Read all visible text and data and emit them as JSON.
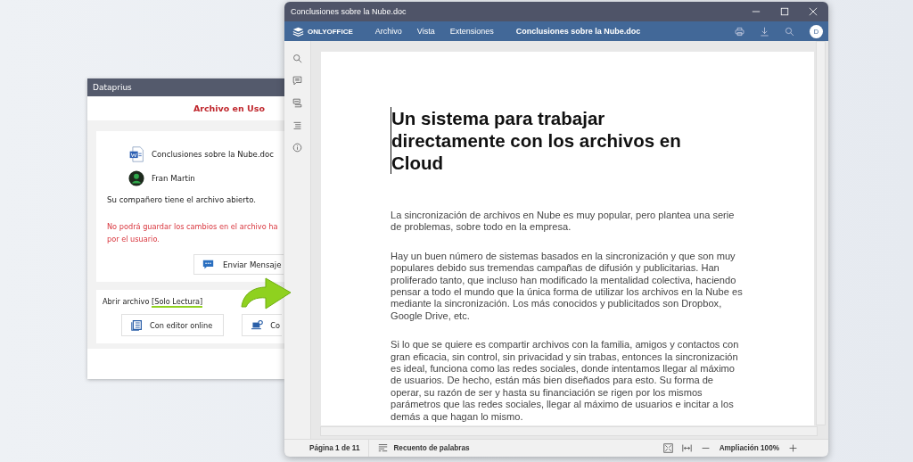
{
  "dialog": {
    "title": "Dataprius",
    "heading": "Archivo en Uso",
    "file_name": "Conclusiones sobre la Nube.doc",
    "user_name": "Fran Martin",
    "info": "Su compañero tiene el archivo abierto.",
    "warning_lines": [
      "No podrá guardar los cambios en el archivo  ha",
      "por el usuario."
    ],
    "message_button": "Enviar Mensaje",
    "open_label_prefix": "Abrir archivo ",
    "open_label_highlight": "[Solo Lectura]",
    "open_buttons": [
      {
        "label": "Con editor online",
        "kind": "online"
      },
      {
        "label": "Co",
        "kind": "desktop"
      }
    ]
  },
  "editor": {
    "window_title": "Conclusiones sobre la Nube.doc",
    "brand": "ONLYOFFICE",
    "menu": [
      "Archivo",
      "Vista",
      "Extensiones"
    ],
    "doc_title": "Conclusiones sobre la Nube.doc",
    "user_initial": "D",
    "sidebar": [
      {
        "kind": "search"
      },
      {
        "kind": "comments"
      },
      {
        "kind": "chat"
      },
      {
        "kind": "navigation"
      },
      {
        "kind": "info"
      }
    ],
    "document": {
      "heading": "Un sistema para trabajar directamente con los archivos en Cloud",
      "paragraphs": [
        "La sincronización de archivos en Nube es muy popular, pero plantea una serie de problemas, sobre todo en la empresa.",
        "Hay un buen número de sistemas basados en la sincronización y que son muy populares debido sus tremendas campañas de difusión y publicitarias. Han proliferado tanto, que incluso han modificado la mentalidad colectiva, haciendo pensar a todo el mundo que la única forma de utilizar los archivos en la Nube es mediante la sincronización. Los más conocidos y publicitados son Dropbox, Google Drive, etc.",
        "Si lo que se quiere es compartir archivos con la familia, amigos y contactos con gran eficacia, sin control, sin privacidad y sin trabas, entonces la sincronización es ideal, funciona como las redes sociales, donde intentamos llegar al máximo de usuarios. De hecho, están más bien diseñados para esto. Su forma de operar, su razón de ser y hasta su financiación se rigen por los mismos parámetros que las redes sociales, llegar al máximo de usuarios e incitar a los demás a que hagan lo mismo."
      ]
    },
    "status": {
      "page": "Página 1 de 11",
      "word_count": "Recuento de palabras",
      "zoom": "Ampliación 100%"
    }
  }
}
